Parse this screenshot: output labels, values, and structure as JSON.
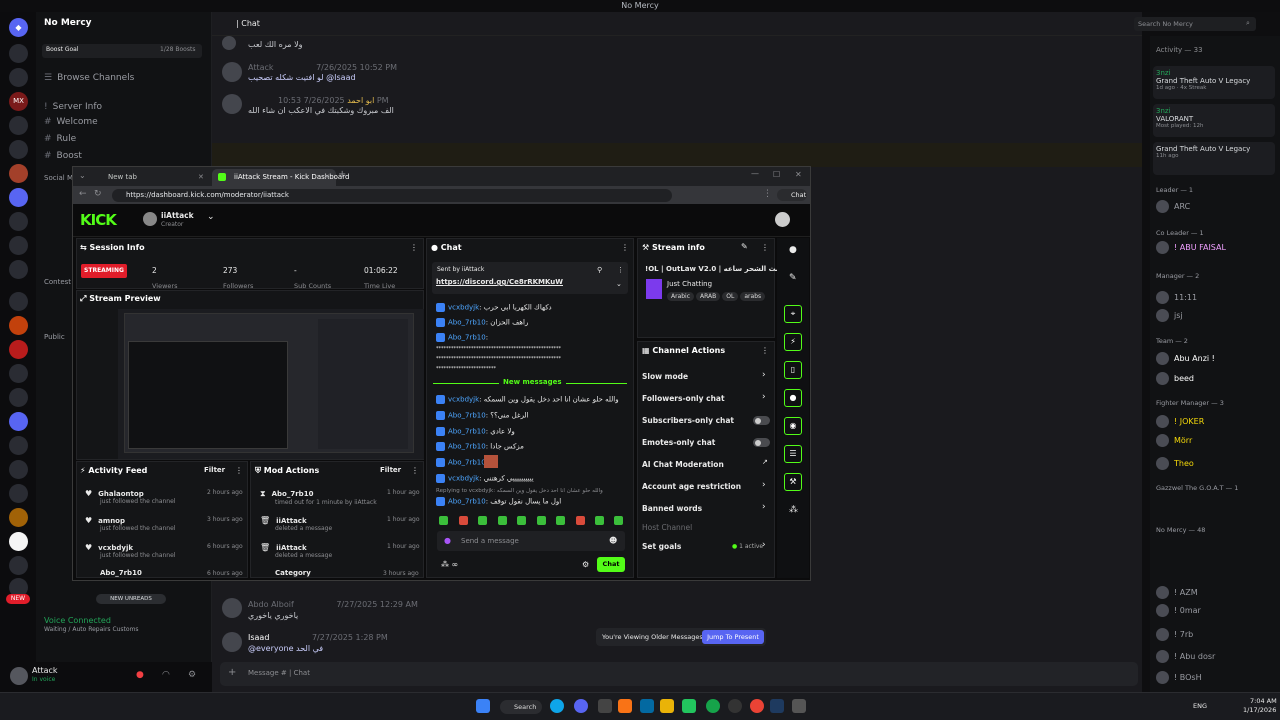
{
  "titlebar": {
    "title": "No Mercy"
  },
  "server_badges": [
    "MX",
    "377",
    "NEW"
  ],
  "sidebar": {
    "server_name": "No Mercy",
    "boost_goal": "Boost Goal",
    "boost_count": "1/28 Boosts",
    "browse": "Browse Channels",
    "channels": [
      "Server Info",
      "Welcome",
      "Rule",
      "Boost"
    ],
    "section_social": "Social M",
    "section_contest": "Contest",
    "section_public": "Public",
    "new_unreads": "NEW UNREADS",
    "voice_connected": "Voice Connected",
    "voice_sub": "Waiting / Auto Repairs Customs",
    "user_name": "Attack",
    "user_status": "In voice"
  },
  "chat_header": {
    "channel": "| Chat",
    "search_placeholder": "Search No Mercy"
  },
  "messages": [
    {
      "user": "",
      "text": "ولا مره الك لعب",
      "time": ""
    },
    {
      "user": "Attack",
      "time": "7/26/2025 10:52 PM",
      "text": "لو افتيت شكله تصحيب @Isaad"
    },
    {
      "user": "ابو احمد",
      "time": "7/26/2025 10:53 PM",
      "text": "الف مبروك وشكبتك في الاعكب ان شاء الله"
    },
    {
      "user": "Abdo Alboif",
      "time": "7/27/2025 12:29 AM",
      "text": "ياخوري ياخوري"
    },
    {
      "user": "Isaad",
      "time": "7/27/2025 1:28 PM",
      "text": "@everyone في الحد"
    }
  ],
  "older_banner": {
    "text": "You're Viewing Older Messages",
    "button": "Jump To Present"
  },
  "message_placeholder": "Message # | Chat",
  "members": {
    "activity_header": "Activity — 33",
    "activities": [
      {
        "user": "3nzi",
        "game": "Grand Theft Auto V Legacy",
        "meta": "1d ago · 4x Streak"
      },
      {
        "user": "3nzi",
        "game": "VALORANT",
        "meta": "Most played: 12h"
      },
      {
        "user": "",
        "game": "Grand Theft Auto V Legacy",
        "meta": "11h ago"
      }
    ],
    "groups": [
      {
        "title": "Leader — 1",
        "names": [
          "ARC"
        ]
      },
      {
        "title": "Co Leader — 1",
        "names": [
          "! ABU FAISAL"
        ]
      },
      {
        "title": "Manager — 2",
        "names": [
          "11:11",
          "jsj"
        ]
      },
      {
        "title": "Team — 2",
        "names": [
          "Abu Anzi !",
          "beed"
        ]
      },
      {
        "title": "Fighter Manager — 3",
        "names": [
          "! JOKER",
          "Mörr",
          "Theo"
        ]
      },
      {
        "title": "Gazzwel The G.O.A.T — 1",
        "names": []
      },
      {
        "title": "No Mercy — 48",
        "names": [
          "! AZM",
          "! 0mar",
          "! 7rb",
          "! Abu dosr",
          "! BOsH"
        ]
      }
    ]
  },
  "taskbar": {
    "search": "Search",
    "lang": "ENG",
    "time": "7:04 AM",
    "date": "1/17/2026"
  },
  "browser": {
    "tabs": [
      "New tab",
      "iiAttack Stream - Kick Dashboard"
    ],
    "url": "https://dashboard.kick.com/moderator/iiattack",
    "chat_button": "Chat"
  },
  "kick": {
    "logo": "KICK",
    "channel_name": "iiAttack",
    "channel_role": "Creator",
    "session": {
      "title": "Session Info",
      "status": "STREAMING",
      "stats": [
        {
          "label": "Viewers",
          "value": "2"
        },
        {
          "label": "Followers",
          "value": "273"
        },
        {
          "label": "Sub Counts",
          "value": "-"
        },
        {
          "label": "Time Live",
          "value": "01:06:22"
        }
      ]
    },
    "preview_title": "Stream Preview",
    "activity_feed": {
      "title": "Activity Feed",
      "filter": "Filter",
      "items": [
        {
          "name": "Ghalaontop",
          "sub": "just followed the channel",
          "time": "2 hours ago"
        },
        {
          "name": "amnop",
          "sub": "just followed the channel",
          "time": "3 hours ago"
        },
        {
          "name": "vcxbdyjk",
          "sub": "just followed the channel",
          "time": "6 hours ago"
        },
        {
          "name": "Abo_7rb10",
          "sub": "",
          "time": "6 hours ago"
        }
      ]
    },
    "mod_actions": {
      "title": "Mod Actions",
      "filter": "Filter",
      "items": [
        {
          "name": "Abo_7rb10",
          "sub": "timed out for 1 minute by iiAttack",
          "time": "1 hour ago"
        },
        {
          "name": "iiAttack",
          "sub": "deleted a message",
          "time": "1 hour ago"
        },
        {
          "name": "iiAttack",
          "sub": "deleted a message",
          "time": "1 hour ago"
        },
        {
          "name": "Category",
          "sub": "",
          "time": "3 hours ago"
        }
      ]
    },
    "chat": {
      "title": "Chat",
      "pinned_by": "Sent by iiAttack",
      "pinned_link": "https://discord.gg/Ce8rRKMKuW",
      "messages_top": [
        {
          "user": "vcxbdyjk",
          "text": "دكهاك الكهربا ابي حرب"
        },
        {
          "user": "Abo_7rb10",
          "text": "راهف الحزان"
        },
        {
          "user": "Abo_7rb10",
          "text": ""
        }
      ],
      "spam": "**************************************************",
      "new_messages": "New messages",
      "messages_bottom": [
        {
          "user": "vcxbdyjk",
          "text": "والله حلو عشان انا احد دخل يقول وين السمكه"
        },
        {
          "user": "Abo_7rb10",
          "text": "الرغل مني؟؟"
        },
        {
          "user": "Abo_7rb10",
          "text": "ولا عادي"
        },
        {
          "user": "Abo_7rb10",
          "text": "مزكس جادا"
        },
        {
          "user": "Abo_7rb10",
          "text": ""
        },
        {
          "user": "vcxbdyjk",
          "text": "ييييييييييي كرهتني"
        }
      ],
      "reply_to": "Replying to vcxbdyjk: والله حلو عشان انا احد دخل يقول وين السمكه",
      "reply_msg": {
        "user": "Abo_7rb10",
        "text": "اول ما يسال نقول توقف"
      },
      "input_placeholder": "Send a message",
      "send": "Chat"
    },
    "stream_info": {
      "title": "Stream info",
      "stream_title": "!OL | OutLaw V2.0 | بث الشحر ساعه",
      "category": "Just Chatting",
      "tags": [
        "Arabic",
        "ARAB",
        "OL",
        "arabs"
      ]
    },
    "channel_actions": {
      "title": "Channel Actions",
      "rows": [
        {
          "label": "Slow mode",
          "kind": "chevron"
        },
        {
          "label": "Followers-only chat",
          "kind": "chevron"
        },
        {
          "label": "Subscribers-only chat",
          "kind": "toggle"
        },
        {
          "label": "Emotes-only chat",
          "kind": "toggle"
        },
        {
          "label": "AI Chat Moderation",
          "kind": "external"
        },
        {
          "label": "Account age restriction",
          "kind": "chevron"
        },
        {
          "label": "Banned words",
          "kind": "chevron"
        },
        {
          "label": "Host Channel",
          "kind": "none"
        },
        {
          "label": "Set goals",
          "kind": "chevron",
          "extra": "1 active"
        }
      ]
    }
  },
  "colors": {
    "kick_green": "#53fc18",
    "streaming_red": "#e11d2a",
    "discord_blurple": "#5865f2"
  }
}
